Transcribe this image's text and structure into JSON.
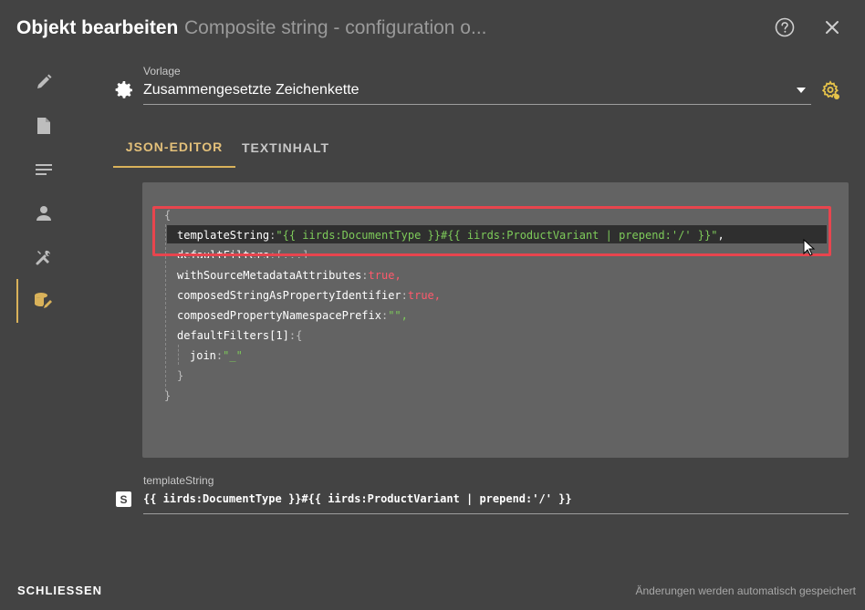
{
  "header": {
    "title": "Objekt bearbeiten",
    "subtitle": "Composite string - configuration o..."
  },
  "icons": {
    "help": "help-icon",
    "close": "close-icon",
    "sidebar": [
      "pencil-icon",
      "document-icon",
      "lines-icon",
      "person-icon",
      "tools-icon",
      "database-edit-icon"
    ],
    "template_settings": "gear-icon",
    "template_config": "cog-settings-icon"
  },
  "sidebar": {
    "active_index": 5
  },
  "template": {
    "label": "Vorlage",
    "value": "Zusammengesetzte Zeichenkette"
  },
  "tabs": [
    {
      "label": "JSON-EDITOR",
      "active": true
    },
    {
      "label": "TEXTINHALT",
      "active": false
    }
  ],
  "editor": {
    "open_brace": "{",
    "close_brace": "}",
    "lines": [
      {
        "key": "templateString",
        "sep": ":",
        "value": "\"{{ iirds:DocumentType }}#{{ iirds:ProductVariant | prepend:'/' }}\"",
        "type": "string",
        "trail": ","
      },
      {
        "key": "defaultFilters",
        "sep": ":",
        "value": "[...]",
        "type": "punct",
        "trail": ""
      },
      {
        "key": "withSourceMetadataAttributes",
        "sep": ":",
        "value": "true",
        "type": "bool",
        "trail": ","
      },
      {
        "key": "composedStringAsPropertyIdentifier",
        "sep": ":",
        "value": "true",
        "type": "bool",
        "trail": ","
      },
      {
        "key": "composedPropertyNamespacePrefix",
        "sep": ":",
        "value": "\"\"",
        "type": "string",
        "trail": ","
      },
      {
        "key": "defaultFilters[1]",
        "sep": ":",
        "value": "{",
        "type": "punct",
        "trail": ""
      }
    ],
    "nested": {
      "key": "join",
      "sep": ":",
      "value": "\"_\"",
      "type": "string"
    },
    "nested_close": "}"
  },
  "template_string": {
    "label": "templateString",
    "badge": "S",
    "value": "{{ iirds:DocumentType }}#{{ iirds:ProductVariant | prepend:'/' }}"
  },
  "footer": {
    "close_label": "SCHLIESSEN",
    "autosave_text": "Änderungen werden automatisch gespeichert"
  },
  "colors": {
    "background": "#434343",
    "editor_bg": "#636363",
    "accent": "#d9b25a",
    "string": "#7ecb5a",
    "boolean": "#ff5a6c",
    "highlight_border": "#e8454e"
  }
}
